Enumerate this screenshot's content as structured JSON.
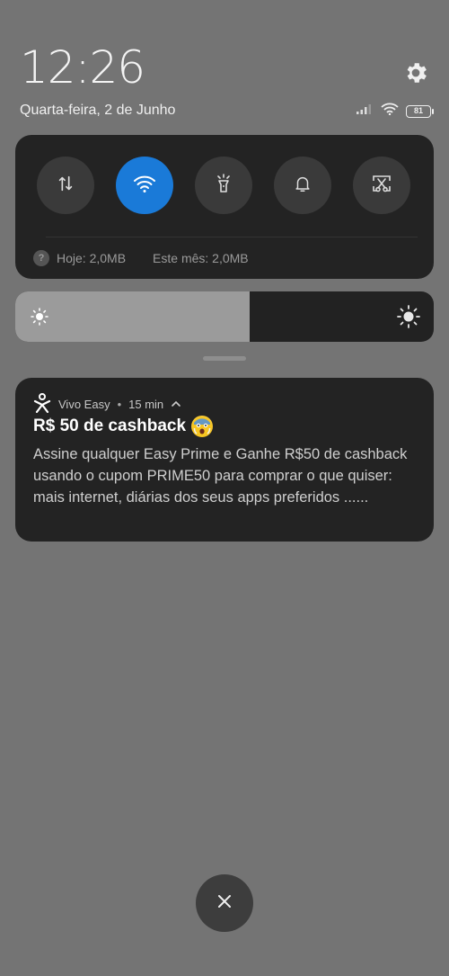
{
  "header": {
    "time": "12:26",
    "date": "Quarta-feira, 2 de Junho",
    "battery_level": "81"
  },
  "quick_settings": {
    "tiles": [
      {
        "name": "mobile-data",
        "icon": "arrows-updown-icon",
        "active": false
      },
      {
        "name": "wifi",
        "icon": "wifi-icon",
        "active": true
      },
      {
        "name": "flashlight",
        "icon": "flashlight-icon",
        "active": false
      },
      {
        "name": "notifications",
        "icon": "bell-icon",
        "active": false
      },
      {
        "name": "screenshot",
        "icon": "scissors-icon",
        "active": false
      }
    ],
    "data_usage": {
      "today": "Hoje: 2,0MB",
      "month": "Este mês: 2,0MB"
    }
  },
  "brightness": {
    "level": 0.56
  },
  "notification": {
    "app": "Vivo Easy",
    "time": "15 min",
    "title": "R$ 50 de cashback",
    "body": "Assine qualquer Easy Prime e Ganhe R$50 de cashback usando o cupom PRIME50 para comprar o que quiser: mais internet, diárias dos seus apps preferidos ......"
  },
  "colors": {
    "background": "#747474",
    "panel": "#232323",
    "accent": "#1a7ad8"
  }
}
